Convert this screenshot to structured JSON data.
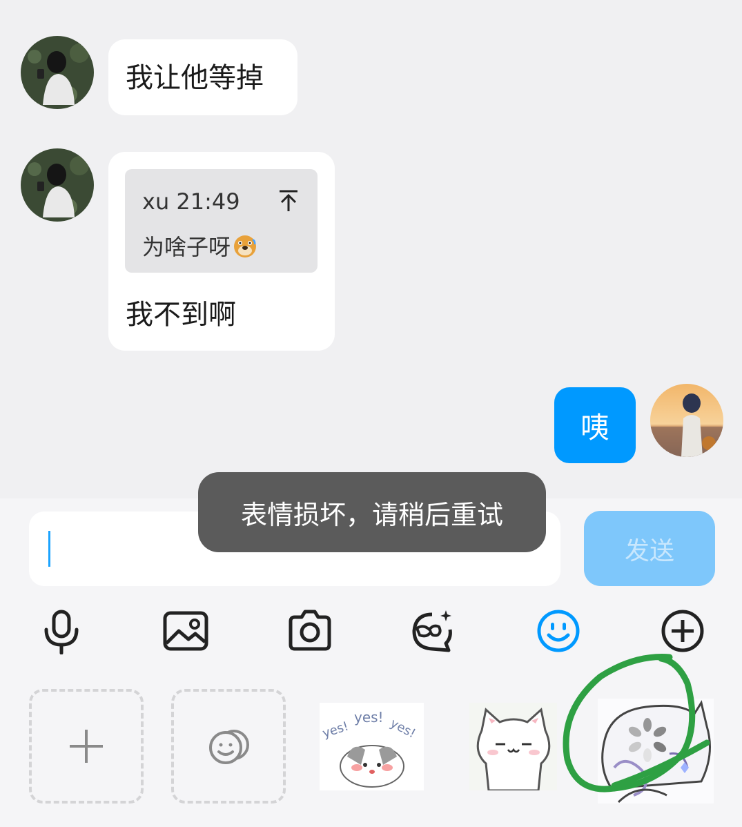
{
  "messages": [
    {
      "sender": "other",
      "text": "我让他等掉"
    },
    {
      "sender": "other",
      "text": "我不到啊",
      "quote": {
        "author_time": "xu 21:49",
        "text": "为啥子呀"
      }
    },
    {
      "sender": "self",
      "text": "咦"
    }
  ],
  "toast": {
    "text": "表情损坏，请稍后重试"
  },
  "composer": {
    "placeholder": "",
    "send_label": "发送"
  },
  "toolbar": {
    "items": [
      "microphone-icon",
      "image-icon",
      "camera-icon",
      "ai-mask-icon",
      "emoji-icon",
      "plus-icon"
    ],
    "active": "emoji-icon"
  },
  "stickers": {
    "items": [
      "add-sticker",
      "manage-stickers",
      "cat-yes-sticker",
      "white-cat-sticker",
      "anime-girl-sticker"
    ],
    "sticker_texts": {
      "yes_cat": "yes! yes! yes!"
    }
  },
  "colors": {
    "accent": "#0099ff",
    "send_disabled": "#7ec7fb",
    "toast_bg": "#5b5b5b",
    "annotation": "#2ea043"
  }
}
